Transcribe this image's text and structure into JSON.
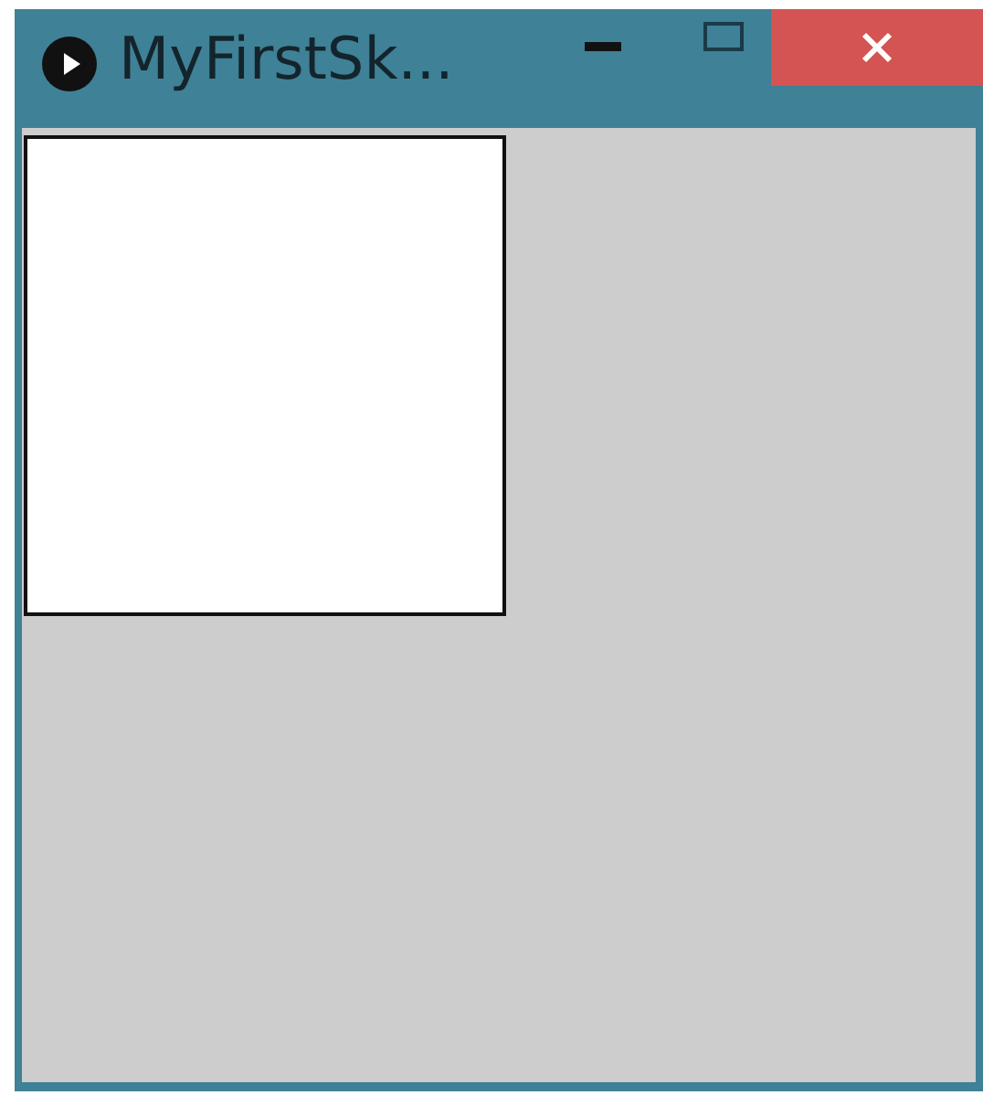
{
  "window": {
    "title": "MyFirstSk..."
  }
}
